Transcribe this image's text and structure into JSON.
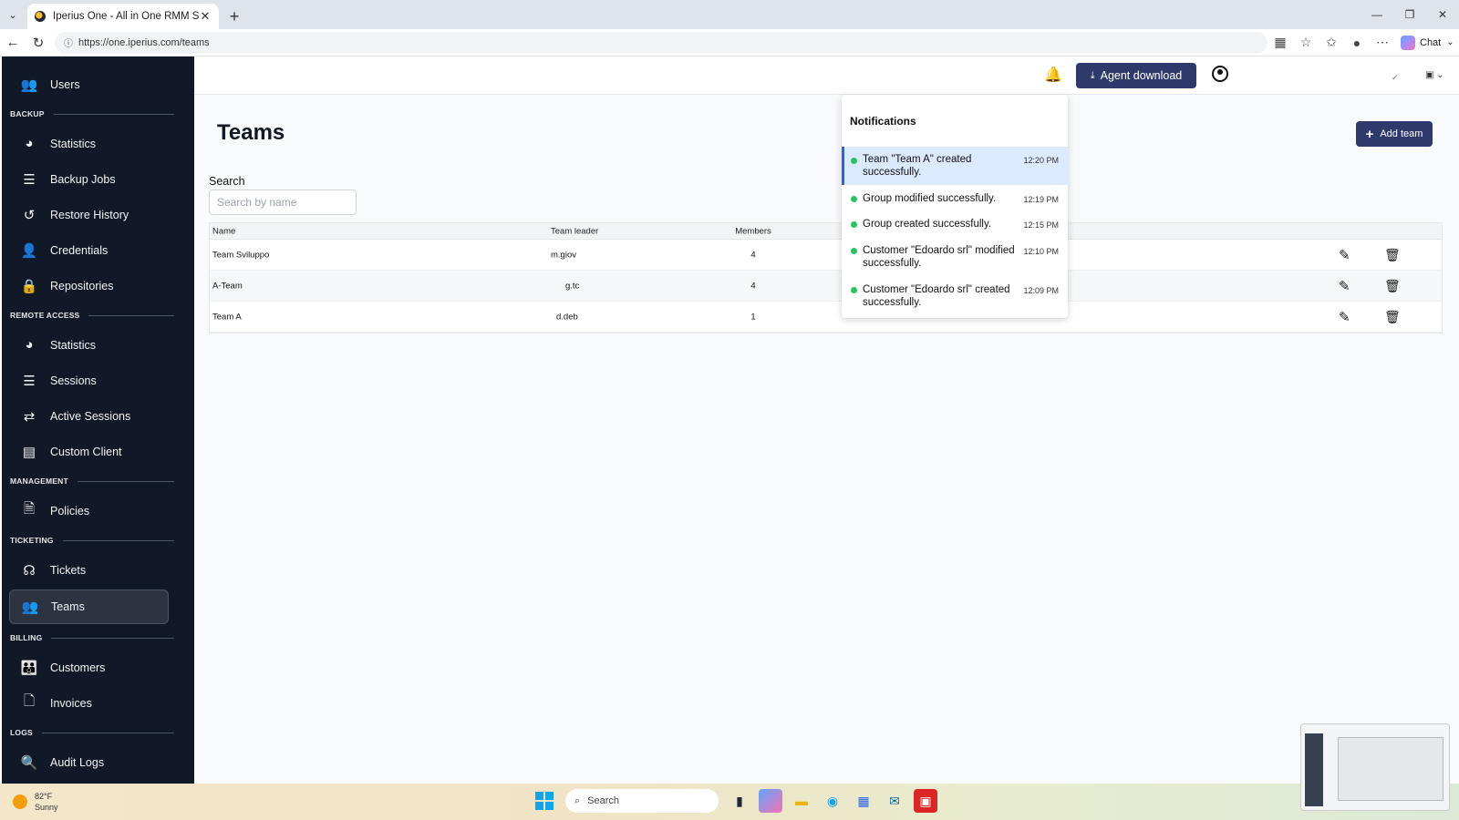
{
  "browser": {
    "tab_title": "Iperius One - All in One RMM Suite",
    "url": "https://one.iperius.com/teams",
    "chat_label": "Chat"
  },
  "sidebar": {
    "top_items": [
      {
        "label": "Users",
        "icon": "users-icon"
      }
    ],
    "sections": [
      {
        "title": "BACKUP",
        "items": [
          {
            "label": "Statistics",
            "icon": "pie-chart-icon"
          },
          {
            "label": "Backup Jobs",
            "icon": "list-icon"
          },
          {
            "label": "Restore History",
            "icon": "history-icon"
          },
          {
            "label": "Credentials",
            "icon": "user-lock-icon"
          },
          {
            "label": "Repositories",
            "icon": "repository-icon"
          }
        ]
      },
      {
        "title": "REMOTE ACCESS",
        "items": [
          {
            "label": "Statistics",
            "icon": "pie-chart-icon"
          },
          {
            "label": "Sessions",
            "icon": "list-icon"
          },
          {
            "label": "Active Sessions",
            "icon": "arrows-icon"
          },
          {
            "label": "Custom Client",
            "icon": "window-icon"
          }
        ]
      },
      {
        "title": "MANAGEMENT",
        "items": [
          {
            "label": "Policies",
            "icon": "policy-icon"
          }
        ]
      },
      {
        "title": "TICKETING",
        "items": [
          {
            "label": "Tickets",
            "icon": "headset-icon"
          },
          {
            "label": "Teams",
            "icon": "team-icon",
            "active": true
          }
        ]
      },
      {
        "title": "BILLING",
        "items": [
          {
            "label": "Customers",
            "icon": "customers-icon"
          },
          {
            "label": "Invoices",
            "icon": "invoice-icon"
          }
        ]
      },
      {
        "title": "LOGS",
        "items": [
          {
            "label": "Audit Logs",
            "icon": "audit-icon"
          }
        ]
      }
    ]
  },
  "header": {
    "agent_download": "Agent download"
  },
  "page": {
    "title": "Teams",
    "add_button": "Add team",
    "search_label": "Search",
    "search_placeholder": "Search by name"
  },
  "table": {
    "columns": [
      "Name",
      "Team leader",
      "Members"
    ],
    "rows": [
      {
        "name": "Team Sviluppo",
        "leader": "m.giov",
        "members": "4"
      },
      {
        "name": "A-Team",
        "leader": "g.tc",
        "members": "4"
      },
      {
        "name": "Team A",
        "leader": "d.deb",
        "members": "1"
      }
    ]
  },
  "notifications": {
    "title": "Notifications",
    "items": [
      {
        "text": "Team \"Team A\" created successfully.",
        "time": "12:20 PM"
      },
      {
        "text": "Group modified successfully.",
        "time": "12:19 PM"
      },
      {
        "text": "Group created successfully.",
        "time": "12:15 PM"
      },
      {
        "text": "Customer \"Edoardo srl\" modified successfully.",
        "time": "12:10 PM"
      },
      {
        "text": "Customer \"Edoardo srl\" created successfully.",
        "time": "12:09 PM"
      }
    ]
  },
  "taskbar": {
    "temperature": "82°F",
    "condition": "Sunny",
    "search_label": "Search"
  },
  "colors": {
    "sidebar": "#111827",
    "primary_button": "#2e3a6b",
    "notif_highlight": "#dbeafe",
    "status_dot": "#22c55e"
  }
}
